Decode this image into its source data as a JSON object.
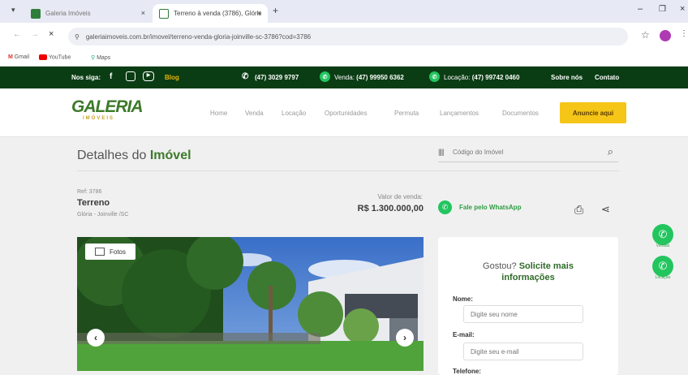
{
  "browser": {
    "tabs": [
      {
        "label": "Galeria Imóveis"
      },
      {
        "label": "Terreno à venda (3786), Glória"
      }
    ],
    "url": "galeriaimoveis.com.br/imovel/terreno-venda-gloria-joinville-sc-3786?cod=3786",
    "bookmarks": [
      "Gmail",
      "YouTube",
      "Maps"
    ]
  },
  "topbar": {
    "follow_label": "Nos siga:",
    "blog": "Blog",
    "phone": "(47) 3029 9797",
    "sales_label": "Venda:",
    "sales_phone": "(47) 99950 6362",
    "rent_label": "Locação:",
    "rent_phone": "(47) 99742 0460",
    "about": "Sobre nós",
    "contact": "Contato"
  },
  "logo": {
    "name": "GALERIA",
    "sub": "IMÓVEIS"
  },
  "nav": {
    "items": [
      "Home",
      "Venda",
      "Locação",
      "Oportunidades",
      "Permuta",
      "Lançamentos",
      "Documentos"
    ],
    "cta": "Anuncie aqui"
  },
  "page": {
    "title_prefix": "Detalhes do ",
    "title_bold": "Imóvel",
    "search_placeholder": "Código do Imóvel"
  },
  "property": {
    "ref": "Ref: 3786",
    "type": "Terreno",
    "location": "Glória - Joinville /SC",
    "price_label": "Valor de venda:",
    "price": "R$ 1.300.000,00",
    "whatsapp_label": "Fale pelo WhatsApp",
    "photos_label": "Fotos"
  },
  "form": {
    "heading_light": "Gostou? ",
    "heading_bold_1": "Solicite mais",
    "heading_bold_2": "informações",
    "name_label": "Nome:",
    "name_placeholder": "Digite seu nome",
    "email_label": "E-mail:",
    "email_placeholder": "Digite seu e-mail",
    "phone_label": "Telefone:"
  },
  "floating": {
    "sales": "Vendas",
    "rent": "Locação"
  },
  "colors": {
    "dark_green": "#0b3d14",
    "whatsapp": "#22c55e",
    "cta": "#f5c518",
    "logo_green": "#3d7a2b"
  }
}
